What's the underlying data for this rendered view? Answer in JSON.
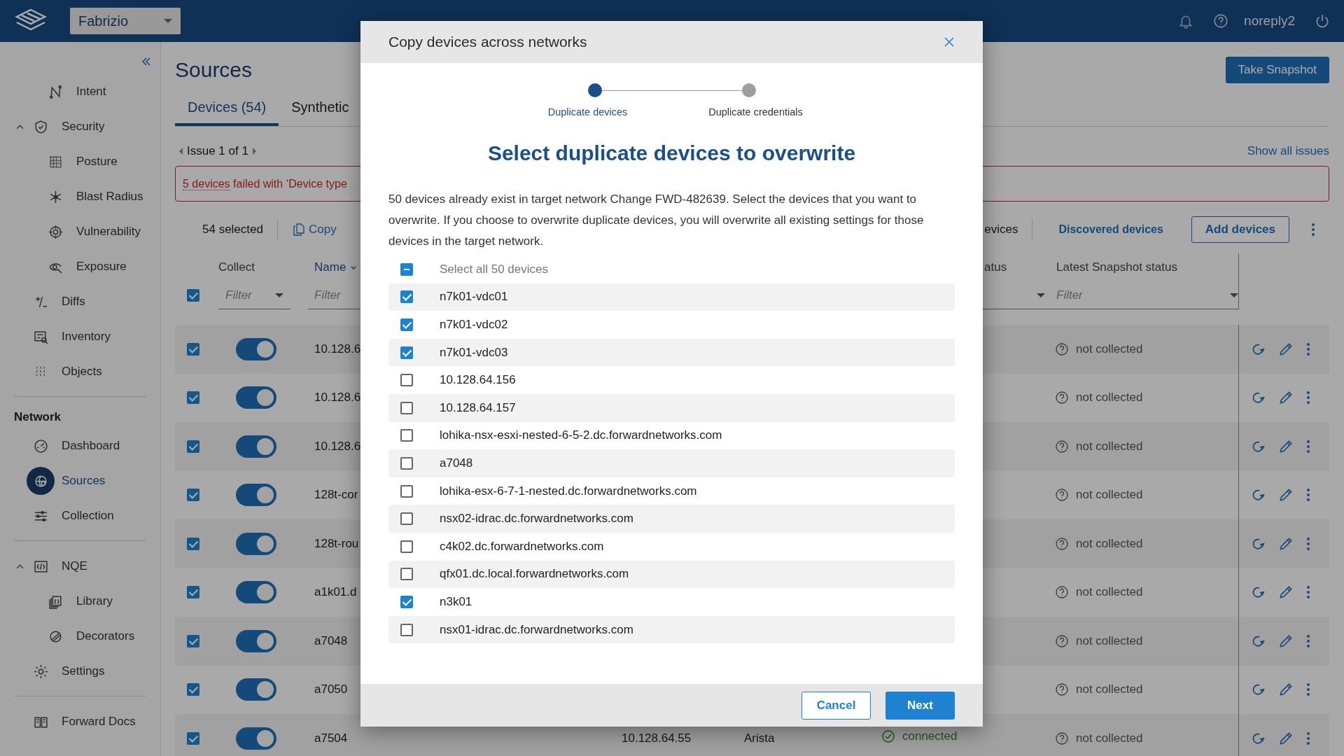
{
  "header": {
    "workspace": "Fabrizio",
    "user": "noreply2"
  },
  "sidebar": {
    "scrolled_children": [
      {
        "label": "Intent",
        "selected": false
      }
    ],
    "groups": [
      {
        "items": [
          {
            "label": "Security",
            "selected": false,
            "expanded": true,
            "children": [
              {
                "label": "Posture",
                "selected": false
              },
              {
                "label": "Blast Radius",
                "selected": false
              },
              {
                "label": "Vulnerability",
                "selected": false
              },
              {
                "label": "Exposure",
                "selected": false
              }
            ]
          },
          {
            "label": "Diffs",
            "selected": false
          },
          {
            "label": "Inventory",
            "selected": false
          },
          {
            "label": "Objects",
            "selected": false
          }
        ]
      },
      {
        "heading": "Network",
        "items": [
          {
            "label": "Dashboard",
            "selected": false
          },
          {
            "label": "Sources",
            "selected": true
          },
          {
            "label": "Collection",
            "selected": false
          }
        ]
      },
      {
        "items": [
          {
            "label": "NQE",
            "selected": false,
            "expanded": true,
            "children": [
              {
                "label": "Library",
                "selected": false
              },
              {
                "label": "Decorators",
                "selected": false
              }
            ]
          },
          {
            "label": "Settings",
            "selected": false
          }
        ]
      },
      {
        "items": [
          {
            "label": "Forward Docs",
            "selected": false
          }
        ]
      }
    ]
  },
  "page": {
    "title": "Sources",
    "primary_action": "Take Snapshot",
    "tabs": [
      {
        "label": "Devices (54)",
        "selected": true
      },
      {
        "label": "Synthetic",
        "selected": false
      }
    ],
    "issues": {
      "pager": "Issue 1 of 1",
      "show_all": "Show all issues",
      "message_link": "5 devices",
      "message": " failed with ‘Device type"
    },
    "toolbar": {
      "selected_count": "54 selected",
      "copy": "Copy",
      "devices_partial": "evices",
      "discovered": "Discovered devices",
      "add": "Add devices"
    },
    "table": {
      "all_selected": true,
      "columns": [
        {
          "label": "Collect",
          "filter": "Filter"
        },
        {
          "label": "Name",
          "sorted": true,
          "filter": "Filter"
        },
        {
          "label": "atus"
        },
        {
          "label": "Latest Snapshot status",
          "filter": "Filter"
        }
      ],
      "rows": [
        {
          "selected": true,
          "collect": true,
          "name": "10.128.6",
          "snapshot": "not collected"
        },
        {
          "selected": true,
          "collect": true,
          "name": "10.128.6",
          "snapshot": "not collected"
        },
        {
          "selected": true,
          "collect": true,
          "name": "10.128.6",
          "snapshot": "not collected"
        },
        {
          "selected": true,
          "collect": true,
          "name": "128t-cor",
          "snapshot": "not collected"
        },
        {
          "selected": true,
          "collect": true,
          "name": "128t-rou",
          "snapshot": "not collected"
        },
        {
          "selected": true,
          "collect": true,
          "name": "a1k01.d",
          "snapshot": "not collected"
        },
        {
          "selected": true,
          "collect": true,
          "name": "a7048",
          "snapshot": "not collected"
        },
        {
          "selected": true,
          "collect": true,
          "name": "a7050",
          "snapshot": "not collected"
        },
        {
          "selected": true,
          "collect": true,
          "name": "a7504",
          "address": "10.128.64.55",
          "vendor": "Arista",
          "status": "connected",
          "snapshot": "not collected"
        }
      ]
    }
  },
  "dialog": {
    "title": "Copy devices across networks",
    "steps": [
      {
        "label": "Duplicate devices",
        "selected": true
      },
      {
        "label": "Duplicate credentials",
        "selected": false
      }
    ],
    "heading": "Select duplicate devices to overwrite",
    "description": "50 devices already exist in target network Change FWD-482639. Select the devices that you want to overwrite. If you choose to overwrite duplicate devices, you will overwrite all existing settings for those devices in the target network.",
    "select_all": {
      "label": "Select all 50 devices",
      "indeterminate": true
    },
    "devices": [
      {
        "name": "n7k01-vdc01",
        "checked": true
      },
      {
        "name": "n7k01-vdc02",
        "checked": true
      },
      {
        "name": "n7k01-vdc03",
        "checked": true
      },
      {
        "name": "10.128.64.156",
        "checked": false
      },
      {
        "name": "10.128.64.157",
        "checked": false
      },
      {
        "name": "lohika-nsx-esxi-nested-6-5-2.dc.forwardnetworks.com",
        "checked": false
      },
      {
        "name": "a7048",
        "checked": false
      },
      {
        "name": "lohika-esx-6-7-1-nested.dc.forwardnetworks.com",
        "checked": false
      },
      {
        "name": "nsx02-idrac.dc.forwardnetworks.com",
        "checked": false
      },
      {
        "name": "c4k02.dc.forwardnetworks.com",
        "checked": false
      },
      {
        "name": "qfx01.dc.local.forwardnetworks.com",
        "checked": false
      },
      {
        "name": "n3k01",
        "checked": true
      },
      {
        "name": "nsx01-idrac.dc.forwardnetworks.com",
        "checked": false
      }
    ],
    "buttons": [
      {
        "label": "Cancel",
        "kind": "secondary"
      },
      {
        "label": "Next",
        "kind": "primary"
      }
    ]
  }
}
